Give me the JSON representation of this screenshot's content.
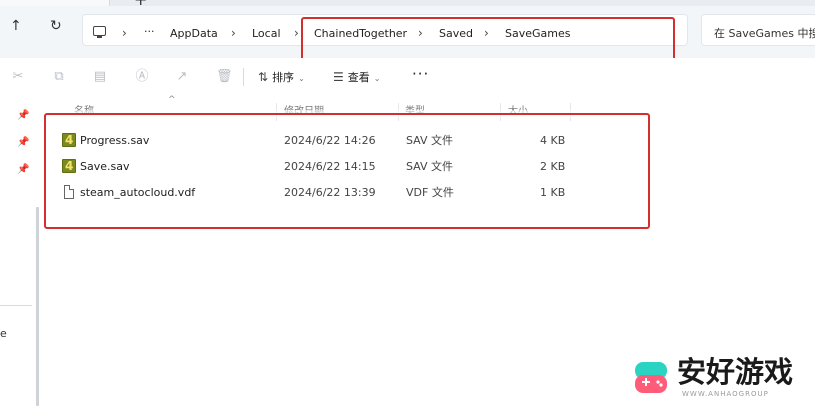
{
  "tabbar": {
    "new_tab_label": "+"
  },
  "nav": {
    "up_icon": "↑",
    "refresh_icon": "↻",
    "crumb_sep": "›",
    "more_icon": "···",
    "breadcrumb": [
      "AppData",
      "Local",
      "ChainedTogether",
      "Saved",
      "SaveGames"
    ]
  },
  "search": {
    "placeholder": "在 SaveGames 中搜"
  },
  "toolbar": {
    "sort_label": "排序",
    "view_label": "查看",
    "more_label": "···"
  },
  "left_pane": {
    "partial_label": "e"
  },
  "columns": [
    "名称",
    "修改日期",
    "类型",
    "大小"
  ],
  "files": [
    {
      "name": "Progress.sav",
      "modified": "2024/6/22 14:26",
      "type": "SAV 文件",
      "size": "4 KB",
      "icon": "sav-file-icon"
    },
    {
      "name": "Save.sav",
      "modified": "2024/6/22 14:15",
      "type": "SAV 文件",
      "size": "2 KB",
      "icon": "sav-file-icon"
    },
    {
      "name": "steam_autocloud.vdf",
      "modified": "2024/6/22 13:39",
      "type": "VDF 文件",
      "size": "1 KB",
      "icon": "text-file-icon"
    }
  ],
  "watermark": {
    "title": "安好游戏",
    "subtitle": "WWW.ANHAOGROUP"
  },
  "colors": {
    "highlight_box": "#d32f2f",
    "addr_bg": "#f3f6f9"
  }
}
